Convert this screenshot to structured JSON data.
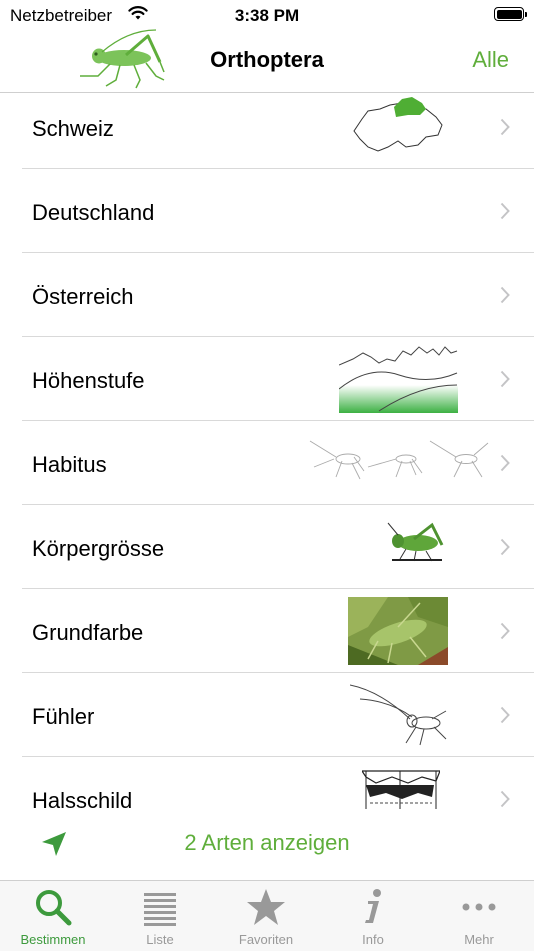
{
  "status": {
    "carrier": "Netzbetreiber",
    "time": "3:38 PM"
  },
  "nav": {
    "title": "Orthoptera",
    "right_label": "Alle"
  },
  "list": {
    "items": [
      {
        "label": "Schweiz"
      },
      {
        "label": "Deutschland"
      },
      {
        "label": "Österreich"
      },
      {
        "label": "Höhenstufe"
      },
      {
        "label": "Habitus"
      },
      {
        "label": "Körpergrösse"
      },
      {
        "label": "Grundfarbe"
      },
      {
        "label": "Fühler"
      },
      {
        "label": "Halsschild"
      }
    ]
  },
  "action": {
    "label": "2 Arten anzeigen",
    "icon": "location-arrow-icon"
  },
  "tabs": [
    {
      "label": "Bestimmen",
      "icon": "search-icon",
      "active": true
    },
    {
      "label": "Liste",
      "icon": "list-icon",
      "active": false
    },
    {
      "label": "Favoriten",
      "icon": "star-icon",
      "active": false
    },
    {
      "label": "Info",
      "icon": "info-icon",
      "active": false
    },
    {
      "label": "Mehr",
      "icon": "more-icon",
      "active": false
    }
  ],
  "colors": {
    "accent": "#5fae3b",
    "tab_active": "#3d9a3d",
    "tab_inactive": "#999999"
  }
}
